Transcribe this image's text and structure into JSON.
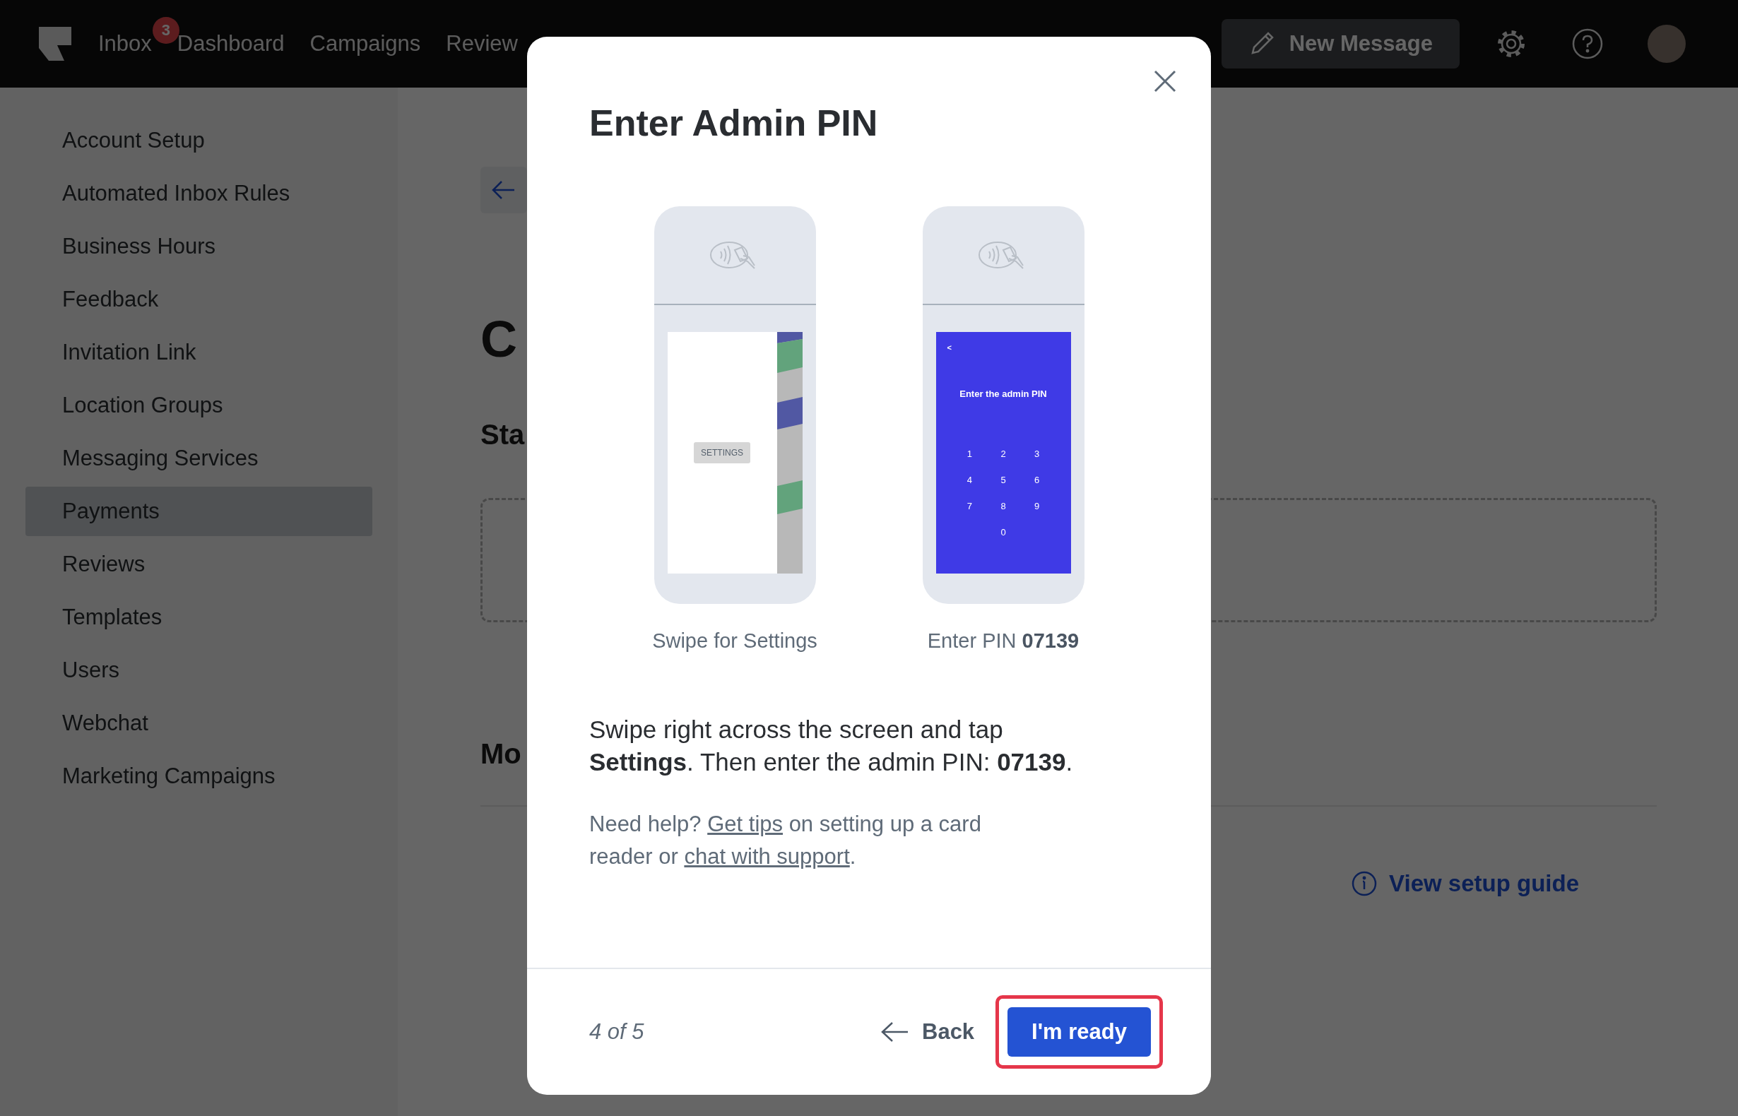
{
  "top_bar": {
    "nav": [
      {
        "label": "Inbox",
        "badge": "3"
      },
      {
        "label": "Dashboard"
      },
      {
        "label": "Campaigns"
      },
      {
        "label": "Review"
      }
    ],
    "new_message": "New Message"
  },
  "sidebar": {
    "items": [
      {
        "label": "Account Setup",
        "selected": false
      },
      {
        "label": "Automated Inbox Rules",
        "selected": false
      },
      {
        "label": "Business Hours",
        "selected": false
      },
      {
        "label": "Feedback",
        "selected": false
      },
      {
        "label": "Invitation Link",
        "selected": false
      },
      {
        "label": "Location Groups",
        "selected": false
      },
      {
        "label": "Messaging Services",
        "selected": false
      },
      {
        "label": "Payments",
        "selected": true
      },
      {
        "label": "Reviews",
        "selected": false
      },
      {
        "label": "Templates",
        "selected": false
      },
      {
        "label": "Users",
        "selected": false
      },
      {
        "label": "Webchat",
        "selected": false
      },
      {
        "label": "Marketing Campaigns",
        "selected": false
      }
    ]
  },
  "main": {
    "heading": "C",
    "section_1": "Sta",
    "section_2": "Mo",
    "setup_link": "View setup guide"
  },
  "modal": {
    "title": "Enter Admin PIN",
    "steps": [
      {
        "kind": "swipe",
        "caption": "Swipe for Settings",
        "screen_button": "SETTINGS"
      },
      {
        "kind": "pin",
        "caption": "Enter PIN **07139**",
        "screen_back": "<",
        "screen_title": "Enter the admin PIN",
        "keys": [
          "1",
          "2",
          "3",
          "4",
          "5",
          "6",
          "7",
          "8",
          "9",
          "0"
        ]
      }
    ],
    "instruction": "Swipe right across the screen and tap **Settings**. Then enter the admin PIN: **07139**.",
    "help": [
      {
        "kind": "text",
        "text": "Need help? "
      },
      {
        "kind": "link",
        "text": "Get tips"
      },
      {
        "kind": "text",
        "text": " on setting up a card reader or "
      },
      {
        "kind": "link",
        "text": "chat with support"
      },
      {
        "kind": "text",
        "text": "."
      }
    ],
    "progress": "4 of 5",
    "back": "Back",
    "primary": "I'm ready"
  }
}
